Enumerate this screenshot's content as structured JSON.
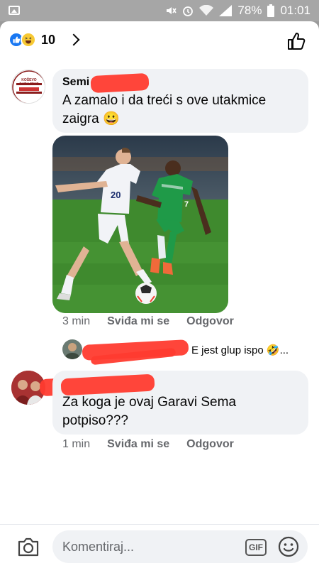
{
  "status_bar": {
    "battery": "78%",
    "time": "01:01"
  },
  "header": {
    "reaction_count": "10",
    "reactions": [
      "like-icon",
      "haha-icon"
    ]
  },
  "comments": [
    {
      "author": "Semi",
      "text_line1": "A zamalo i da treći s ove utakmice",
      "text_line2": "zaigra 😀",
      "avatar_label": "KOŠEVO SARAJEVO",
      "time": "3 min",
      "like_label": "Sviđa mi se",
      "reply_label": "Odgovor",
      "has_photo": true
    },
    {
      "author": "",
      "text_line1": "Za koga je ovaj Garavi Sema",
      "text_line2": "potpiso???",
      "time": "1 min",
      "like_label": "Sviđa mi se",
      "reply_label": "Odgovor"
    }
  ],
  "reply_preview": {
    "text": "E jest glup ispo 🤣..."
  },
  "composer": {
    "placeholder": "Komentiraj...",
    "gif_label": "GIF"
  },
  "photo": {
    "player_white_number": "20",
    "player_green_number": "7",
    "colors": {
      "pitch": "#3f8a2e",
      "white_kit": "#f2f3f7",
      "green_kit": "#1f9a48"
    }
  },
  "colors": {
    "bubble": "#f0f2f5",
    "text": "#050505",
    "meta": "#65676b",
    "like_blue": "#1877f2",
    "redaction": "#ff3b2f"
  }
}
